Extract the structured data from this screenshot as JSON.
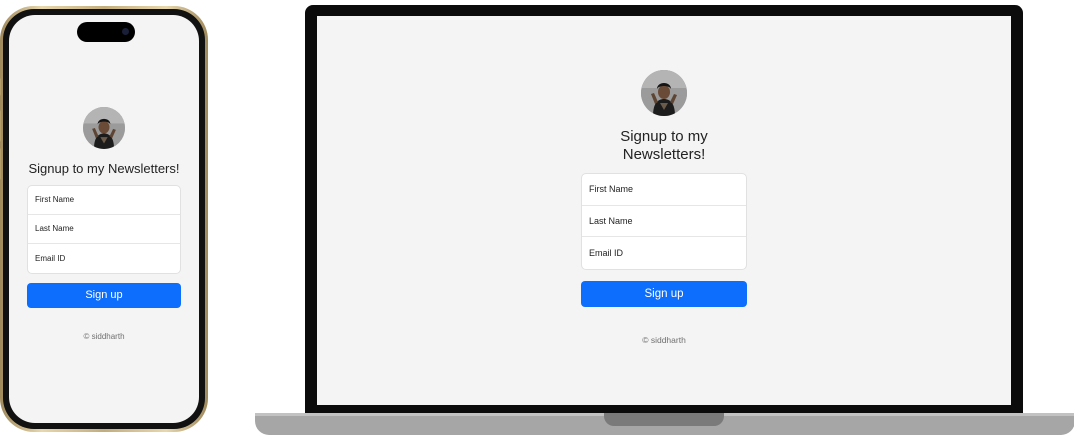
{
  "form": {
    "heading": "Signup to my Newsletters!",
    "fields": [
      {
        "placeholder": "First Name",
        "value": ""
      },
      {
        "placeholder": "Last Name",
        "value": ""
      },
      {
        "placeholder": "Email ID",
        "value": ""
      }
    ],
    "submit_label": "Sign up",
    "footer": "© siddharth"
  },
  "colors": {
    "accent": "#0d6efd",
    "page_background": "#f4f4f4",
    "button_text": "#ffffff"
  },
  "icons": {
    "avatar": "profile-photo"
  }
}
